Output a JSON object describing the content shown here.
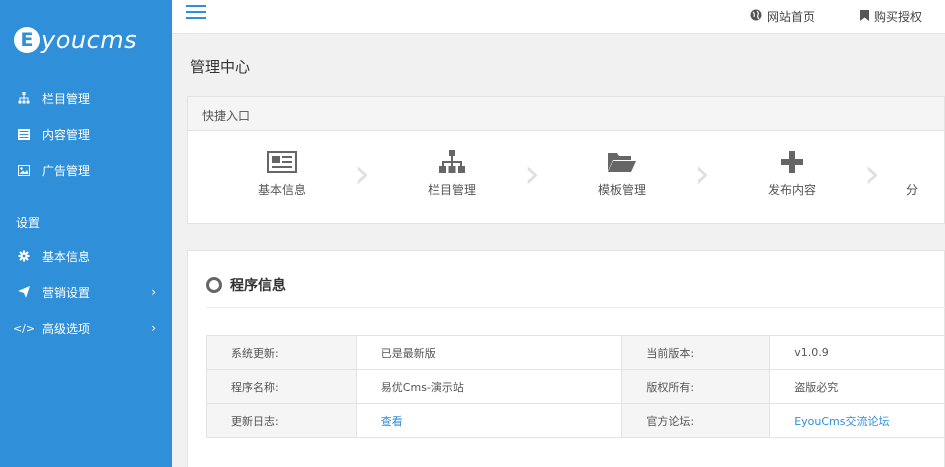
{
  "sidebar": {
    "logo_letter": "E",
    "logo_text": "youcms",
    "items": [
      {
        "label": "栏目管理",
        "icon": "sitemap-icon"
      },
      {
        "label": "内容管理",
        "icon": "list-icon"
      },
      {
        "label": "广告管理",
        "icon": "image-icon"
      }
    ],
    "group_label": "设置",
    "settings": [
      {
        "label": "基本信息",
        "icon": "gear-icon"
      },
      {
        "label": "营销设置",
        "icon": "paper-plane-icon"
      },
      {
        "label": "高级选项",
        "icon": "code-icon"
      }
    ]
  },
  "topbar": {
    "home_label": "网站首页",
    "buy_label": "购买授权"
  },
  "main": {
    "title": "管理中心",
    "quick_title": "快捷入口",
    "quick_items": [
      {
        "label": "基本信息",
        "icon": "newspaper-icon"
      },
      {
        "label": "栏目管理",
        "icon": "sitemap-icon"
      },
      {
        "label": "模板管理",
        "icon": "folder-open-icon"
      },
      {
        "label": "发布内容",
        "icon": "plus-icon"
      },
      {
        "label": "分",
        "icon": "partial-icon"
      }
    ],
    "info_title": "程序信息",
    "info_rows": [
      {
        "k1": "系统更新:",
        "v1": "已是最新版",
        "k2": "当前版本:",
        "v2": "v1.0.9"
      },
      {
        "k1": "程序名称:",
        "v1": "易优Cms-演示站",
        "k2": "版权所有:",
        "v2": "盗版必究"
      },
      {
        "k1": "更新日志:",
        "v1": "查看",
        "k2": "官方论坛:",
        "v2": "EyouCms交流论坛"
      }
    ]
  },
  "colors": {
    "sidebar_bg": "#2f8fd8",
    "accent": "#2f8fd8"
  }
}
